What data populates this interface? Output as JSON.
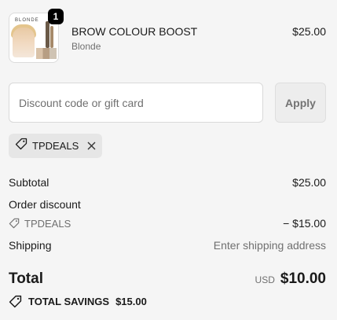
{
  "product": {
    "quantity": "1",
    "name": "BROW COLOUR BOOST",
    "variant": "Blonde",
    "price": "$25.00",
    "thumbnail_brand": "BLONDE"
  },
  "discount": {
    "placeholder": "Discount code or gift card",
    "value": "",
    "apply_label": "Apply"
  },
  "applied_code": {
    "code": "TPDEALS",
    "icons": [
      "tag-icon",
      "close-icon"
    ]
  },
  "summary": {
    "subtotal_label": "Subtotal",
    "subtotal_value": "$25.00",
    "order_discount_label": "Order discount",
    "discount_code": "TPDEALS",
    "discount_value": "− $15.00",
    "shipping_label": "Shipping",
    "shipping_value": "Enter shipping address"
  },
  "total": {
    "label": "Total",
    "currency": "USD",
    "amount": "$10.00"
  },
  "savings": {
    "label": "TOTAL SAVINGS",
    "amount": "$15.00"
  },
  "colors": {
    "background": "#f5f5f5",
    "text": "#1a1a1a",
    "muted": "#707070",
    "badge": "#000000"
  }
}
